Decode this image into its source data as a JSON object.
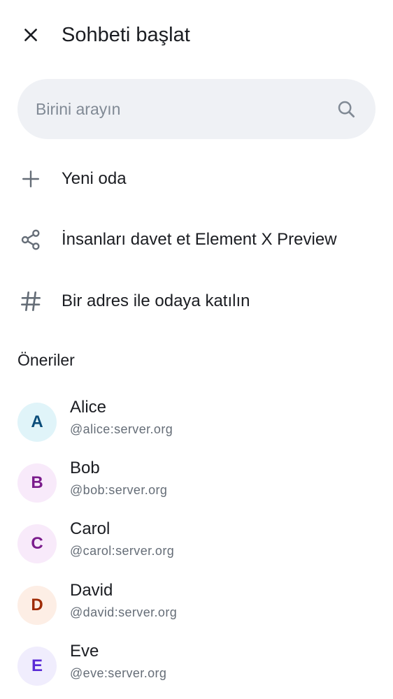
{
  "header": {
    "title": "Sohbeti başlat",
    "close_icon": "close-icon"
  },
  "search": {
    "placeholder": "Birini arayın",
    "value": "",
    "icon": "search-icon"
  },
  "actions": [
    {
      "label": "Yeni oda",
      "icon": "plus-icon"
    },
    {
      "label": "İnsanları davet et Element X Preview",
      "icon": "share-icon"
    },
    {
      "label": "Bir adres ile odaya katılın",
      "icon": "hash-icon"
    }
  ],
  "suggestions": {
    "title": "Öneriler",
    "users": [
      {
        "initial": "A",
        "name": "Alice",
        "id": "@alice:server.org",
        "bg": "#e0f4f9",
        "fg": "#0b4d7a"
      },
      {
        "initial": "B",
        "name": "Bob",
        "id": "@bob:server.org",
        "bg": "#f8eafa",
        "fg": "#7b1c8c"
      },
      {
        "initial": "C",
        "name": "Carol",
        "id": "@carol:server.org",
        "bg": "#f8eafa",
        "fg": "#7b1c8c"
      },
      {
        "initial": "D",
        "name": "David",
        "id": "@david:server.org",
        "bg": "#fdeee5",
        "fg": "#9e2a05"
      },
      {
        "initial": "E",
        "name": "Eve",
        "id": "@eve:server.org",
        "bg": "#f0edfd",
        "fg": "#5a2bd6"
      }
    ]
  },
  "colors": {
    "text": "#1b1d22",
    "secondary": "#656d77",
    "search_bg": "#eff1f5",
    "icon": "#656d77"
  }
}
